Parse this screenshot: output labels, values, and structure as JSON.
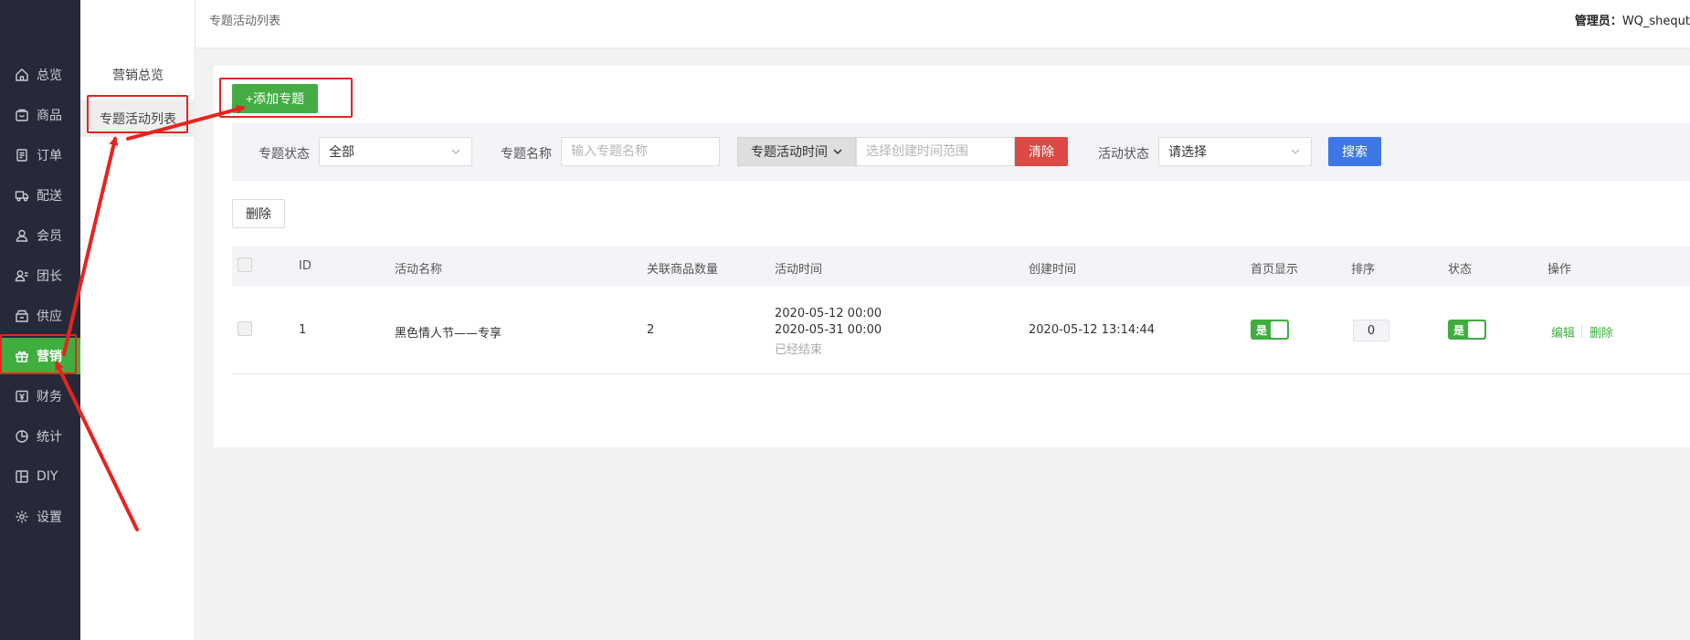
{
  "header": {
    "breadcrumb": "专题活动列表",
    "admin_label": "管理员：",
    "admin_name": "WQ_shequt"
  },
  "sidebar": {
    "items": [
      {
        "label": "总览",
        "icon": "home-icon"
      },
      {
        "label": "商品",
        "icon": "goods-icon"
      },
      {
        "label": "订单",
        "icon": "order-icon"
      },
      {
        "label": "配送",
        "icon": "delivery-icon"
      },
      {
        "label": "会员",
        "icon": "member-icon"
      },
      {
        "label": "团长",
        "icon": "leader-icon"
      },
      {
        "label": "供应",
        "icon": "supply-icon"
      },
      {
        "label": "营销",
        "icon": "gift-icon",
        "active": true
      },
      {
        "label": "财务",
        "icon": "finance-icon"
      },
      {
        "label": "统计",
        "icon": "pie-chart-icon"
      },
      {
        "label": "DIY",
        "icon": "layout-icon"
      },
      {
        "label": "设置",
        "icon": "gear-icon"
      }
    ]
  },
  "subnav": {
    "items": [
      {
        "label": "营销总览"
      },
      {
        "label": "专题活动列表",
        "active": true
      }
    ]
  },
  "toolbar": {
    "add_label": "+添加专题",
    "delete_label": "删除"
  },
  "filters": {
    "status_label": "专题状态",
    "status_value": "全部",
    "name_label": "专题名称",
    "name_placeholder": "输入专题名称",
    "time_type": "专题活动时间",
    "time_placeholder": "选择创建时间范围",
    "clear_label": "清除",
    "activity_status_label": "活动状态",
    "activity_status_placeholder": "请选择",
    "search_label": "搜索"
  },
  "table": {
    "columns": [
      "ID",
      "活动名称",
      "关联商品数量",
      "活动时间",
      "创建时间",
      "首页显示",
      "排序",
      "状态",
      "操作"
    ],
    "rows": [
      {
        "id": "1",
        "name": "黑色情人节——专享",
        "goods_count": "2",
        "start": "2020-05-12 00:00",
        "end": "2020-05-31 00:00",
        "time_status": "已经结束",
        "created": "2020-05-12 13:14:44",
        "home_display": "是",
        "sort": "0",
        "status": "是",
        "edit_label": "编辑",
        "delete_label": "删除"
      }
    ]
  },
  "colors": {
    "sidebar_bg": "#262a38",
    "accent_green": "#3fae3f",
    "danger_red": "#dc4a45",
    "primary_blue": "#3f78e6",
    "annotation_red": "#e8231f"
  }
}
